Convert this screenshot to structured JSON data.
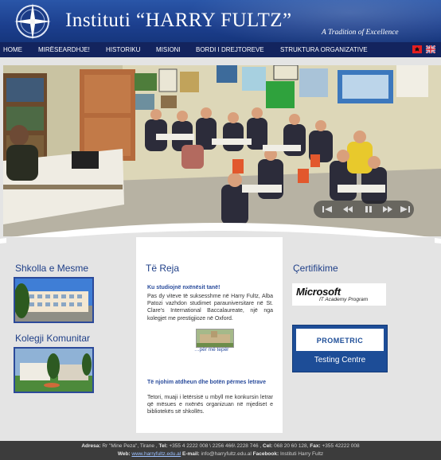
{
  "header": {
    "title": "Instituti “HARRY FULTZ”",
    "tagline": "A Tradition of Excellence"
  },
  "nav": {
    "items": [
      {
        "label": "HOME"
      },
      {
        "label": "MIRËSEARDHJE!"
      },
      {
        "label": "HISTORIKU"
      },
      {
        "label": "MISIONI"
      },
      {
        "label": "BORDI I DREJTOREVE"
      },
      {
        "label": "STRUKTURA ORGANIZATIVE"
      }
    ],
    "languages": [
      "albanian-flag-icon",
      "uk-flag-icon"
    ]
  },
  "left": {
    "section1_title": "Shkolla e Mesme",
    "section2_title": "Kolegji Komunitar"
  },
  "middle": {
    "title": "Të Reja",
    "news": [
      {
        "headline": "Ku studiojnë nxënësit tanë!",
        "body": "Pas dy viteve të suksesshme në Harry Fultz, Alba Patozi vazhdon studimet parauniversitare në St. Clare's International Baccalaureate, një nga kolegjet me prestigjioze në Oxford.",
        "more": "…për më tepër"
      },
      {
        "headline": "Të njohim atdheun dhe botën përmes letrave",
        "body": "Tetori, muaji i letërsisë u mbyll me konkursin letrar që mësues e nxënës organizuan në mjediset e bibliotekës së shkollës."
      }
    ]
  },
  "right": {
    "title": "Çertifikime",
    "microsoft": {
      "brand": "Microsoft",
      "line": "IT Academy Program"
    },
    "prometric": {
      "brand": "PROMETRIC",
      "line": "Testing Centre"
    }
  },
  "footer": {
    "line1_address_label": "Adresa:",
    "line1_address": "Rr \"Mine Peza\", Tirane ,",
    "line1_tel_label": "Tel:",
    "line1_tel": "+355 4 2222 008 \\ 2256 466\\ 2228 746 ,",
    "line1_cel_label": "Cel:",
    "line1_cel": "068 20 60 128,",
    "line1_fax_label": "Fax:",
    "line1_fax": "+355 42222 008",
    "line2_web_label": "Web:",
    "line2_web": "www.harryfultz.edu.al",
    "line2_email_label": "E-mail:",
    "line2_email": "info@harryfultz.edu.al",
    "line2_fb_label": "Facebook:",
    "line2_fb": "Instituti Harry Fultz"
  }
}
